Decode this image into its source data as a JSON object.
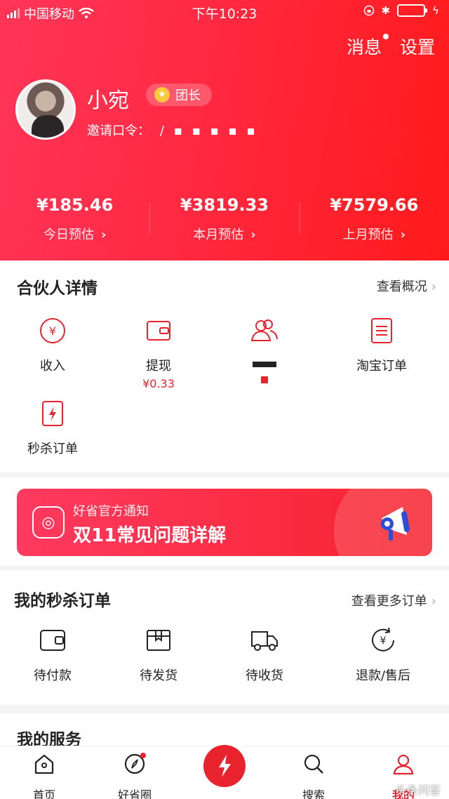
{
  "status_bar": {
    "carrier": "中国移动",
    "time": "下午10:23"
  },
  "header": {
    "messages_label": "消息",
    "settings_label": "设置",
    "user_name": "小宛",
    "badge_label": "团长",
    "invite_label": "邀请口令：",
    "invite_code": "/ ▪ ▪ ▪ ▪ ▪"
  },
  "stats": [
    {
      "amount": "¥185.46",
      "label": "今日预估"
    },
    {
      "amount": "¥3819.33",
      "label": "本月预估"
    },
    {
      "amount": "¥7579.66",
      "label": "上月预估"
    }
  ],
  "partner": {
    "title": "合伙人详情",
    "more_label": "查看概况",
    "items": [
      {
        "label": "收入",
        "icon": "yen-circle-icon"
      },
      {
        "label": "提现",
        "sub": "¥0.33",
        "icon": "wallet-icon"
      },
      {
        "label": "",
        "icon": "users-icon"
      },
      {
        "label": "淘宝订单",
        "icon": "list-icon"
      },
      {
        "label": "秒杀订单",
        "icon": "flash-order-icon"
      }
    ]
  },
  "banner": {
    "subtitle": "好省官方通知",
    "title": "双11常见问题详解"
  },
  "orders": {
    "title": "我的秒杀订单",
    "more_label": "查看更多订单",
    "items": [
      {
        "label": "待付款",
        "icon": "wallet-icon"
      },
      {
        "label": "待发货",
        "icon": "box-icon"
      },
      {
        "label": "待收货",
        "icon": "truck-icon"
      },
      {
        "label": "退款/售后",
        "icon": "refund-icon"
      }
    ]
  },
  "services": {
    "title": "我的服务"
  },
  "tabbar": {
    "tabs": [
      {
        "label": "首页",
        "icon": "home-icon"
      },
      {
        "label": "好省圈",
        "icon": "compass-icon"
      },
      {
        "label": "",
        "icon": "lightning-icon"
      },
      {
        "label": "搜索",
        "icon": "search-icon"
      },
      {
        "label": "我的",
        "icon": "user-icon"
      }
    ]
  },
  "watermark": "头条问答",
  "colors": {
    "brand": "#ff2a44",
    "accent": "#e8232d"
  }
}
